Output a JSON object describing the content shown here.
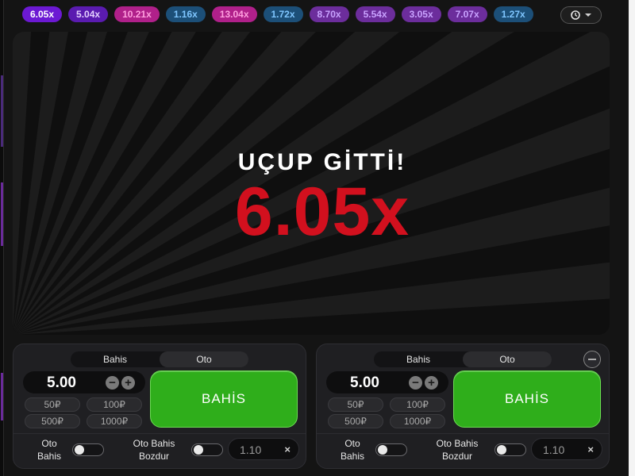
{
  "history": [
    {
      "value": "6.05x",
      "color": "#6c19d3"
    },
    {
      "value": "5.04x",
      "color": "#5a1bb0"
    },
    {
      "value": "10.21x",
      "color": "#b0208a"
    },
    {
      "value": "1.16x",
      "color": "#1c4f78"
    },
    {
      "value": "13.04x",
      "color": "#b0208a"
    },
    {
      "value": "1.72x",
      "color": "#1c4f78"
    },
    {
      "value": "8.70x",
      "color": "#6c2d9c"
    },
    {
      "value": "5.54x",
      "color": "#6c2d9c"
    },
    {
      "value": "3.05x",
      "color": "#6c2d9c"
    },
    {
      "value": "7.07x",
      "color": "#6c2d9c"
    },
    {
      "value": "1.27x",
      "color": "#1c4f78"
    }
  ],
  "history_button": {
    "icon": "history-icon",
    "caret": "caret-down-icon"
  },
  "game": {
    "status_text": "UÇUP GİTTİ!",
    "multiplier": "6.05x",
    "multiplier_color": "#d2101e"
  },
  "panels": [
    {
      "tabs": [
        "Bahis",
        "Oto"
      ],
      "active_tab": "Oto",
      "amount": "5.00",
      "quick_amounts": [
        "50₽",
        "100₽",
        "500₽",
        "1000₽"
      ],
      "bet_label": "BAHİS",
      "auto_bet_label_line1": "Oto",
      "auto_bet_label_line2": "Bahis",
      "auto_cashout_label_line1": "Oto Bahis",
      "auto_cashout_label_line2": "Bozdur",
      "cashout_value": "1.10",
      "cashout_clear": "×"
    },
    {
      "tabs": [
        "Bahis",
        "Oto"
      ],
      "active_tab": "Oto",
      "amount": "5.00",
      "quick_amounts": [
        "50₽",
        "100₽",
        "500₽",
        "1000₽"
      ],
      "bet_label": "BAHİS",
      "auto_bet_label_line1": "Oto",
      "auto_bet_label_line2": "Bahis",
      "auto_cashout_label_line1": "Oto Bahis",
      "auto_cashout_label_line2": "Bozdur",
      "cashout_value": "1.10",
      "cashout_clear": "×"
    }
  ],
  "colors": {
    "bet_button": "#2fae1b",
    "background": "#141414"
  }
}
